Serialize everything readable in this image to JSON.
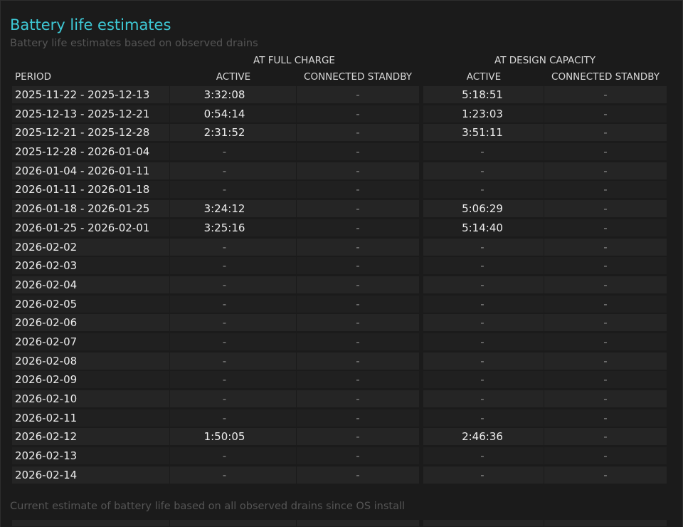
{
  "title": "Battery life estimates",
  "subtitle": "Battery life estimates based on observed drains",
  "groups": {
    "full_charge": "AT FULL CHARGE",
    "design_capacity": "AT DESIGN CAPACITY"
  },
  "columns": {
    "period": "PERIOD",
    "fc_active": "ACTIVE",
    "fc_standby": "CONNECTED STANDBY",
    "dc_active": "ACTIVE",
    "dc_standby": "CONNECTED STANDBY"
  },
  "rows": [
    {
      "period": "2025-11-22 - 2025-12-13",
      "fc_active": "3:32:08",
      "fc_standby": "-",
      "dc_active": "5:18:51",
      "dc_standby": "-"
    },
    {
      "period": "2025-12-13 - 2025-12-21",
      "fc_active": "0:54:14",
      "fc_standby": "-",
      "dc_active": "1:23:03",
      "dc_standby": "-"
    },
    {
      "period": "2025-12-21 - 2025-12-28",
      "fc_active": "2:31:52",
      "fc_standby": "-",
      "dc_active": "3:51:11",
      "dc_standby": "-"
    },
    {
      "period": "2025-12-28 - 2026-01-04",
      "fc_active": "-",
      "fc_standby": "-",
      "dc_active": "-",
      "dc_standby": "-"
    },
    {
      "period": "2026-01-04 - 2026-01-11",
      "fc_active": "-",
      "fc_standby": "-",
      "dc_active": "-",
      "dc_standby": "-"
    },
    {
      "period": "2026-01-11 - 2026-01-18",
      "fc_active": "-",
      "fc_standby": "-",
      "dc_active": "-",
      "dc_standby": "-"
    },
    {
      "period": "2026-01-18 - 2026-01-25",
      "fc_active": "3:24:12",
      "fc_standby": "-",
      "dc_active": "5:06:29",
      "dc_standby": "-"
    },
    {
      "period": "2026-01-25 - 2026-02-01",
      "fc_active": "3:25:16",
      "fc_standby": "-",
      "dc_active": "5:14:40",
      "dc_standby": "-"
    },
    {
      "period": "2026-02-02",
      "fc_active": "-",
      "fc_standby": "-",
      "dc_active": "-",
      "dc_standby": "-"
    },
    {
      "period": "2026-02-03",
      "fc_active": "-",
      "fc_standby": "-",
      "dc_active": "-",
      "dc_standby": "-"
    },
    {
      "period": "2026-02-04",
      "fc_active": "-",
      "fc_standby": "-",
      "dc_active": "-",
      "dc_standby": "-"
    },
    {
      "period": "2026-02-05",
      "fc_active": "-",
      "fc_standby": "-",
      "dc_active": "-",
      "dc_standby": "-"
    },
    {
      "period": "2026-02-06",
      "fc_active": "-",
      "fc_standby": "-",
      "dc_active": "-",
      "dc_standby": "-"
    },
    {
      "period": "2026-02-07",
      "fc_active": "-",
      "fc_standby": "-",
      "dc_active": "-",
      "dc_standby": "-"
    },
    {
      "period": "2026-02-08",
      "fc_active": "-",
      "fc_standby": "-",
      "dc_active": "-",
      "dc_standby": "-"
    },
    {
      "period": "2026-02-09",
      "fc_active": "-",
      "fc_standby": "-",
      "dc_active": "-",
      "dc_standby": "-"
    },
    {
      "period": "2026-02-10",
      "fc_active": "-",
      "fc_standby": "-",
      "dc_active": "-",
      "dc_standby": "-"
    },
    {
      "period": "2026-02-11",
      "fc_active": "-",
      "fc_standby": "-",
      "dc_active": "-",
      "dc_standby": "-"
    },
    {
      "period": "2026-02-12",
      "fc_active": "1:50:05",
      "fc_standby": "-",
      "dc_active": "2:46:36",
      "dc_standby": "-"
    },
    {
      "period": "2026-02-13",
      "fc_active": "-",
      "fc_standby": "-",
      "dc_active": "-",
      "dc_standby": "-"
    },
    {
      "period": "2026-02-14",
      "fc_active": "-",
      "fc_standby": "-",
      "dc_active": "-",
      "dc_standby": "-"
    }
  ],
  "footer_note": "Current estimate of battery life based on all observed drains since OS install",
  "colors": {
    "accent": "#3ec9d6",
    "background": "#1b1b1b",
    "row_dark": "#202020",
    "row_light": "#252525"
  }
}
